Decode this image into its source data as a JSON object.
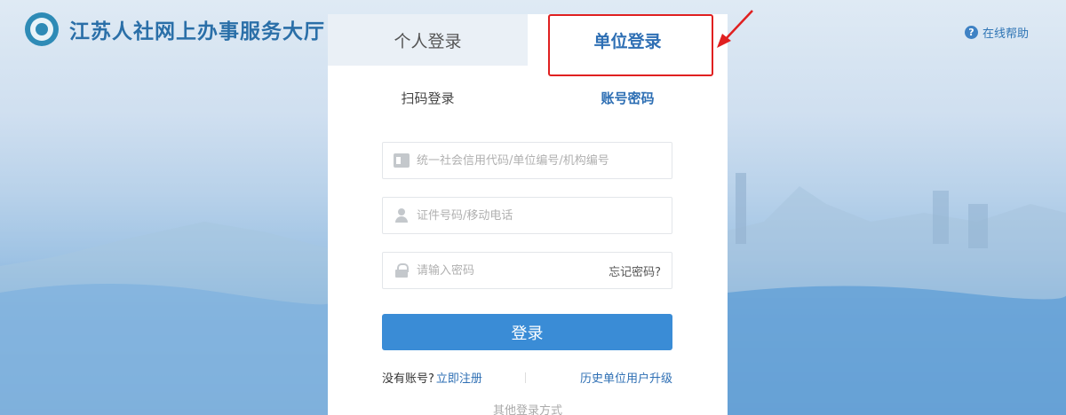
{
  "header": {
    "title": "江苏人社网上办事服务大厅",
    "help_label": "在线帮助"
  },
  "tabs": [
    {
      "label": "个人登录",
      "active": false
    },
    {
      "label": "单位登录",
      "active": true
    }
  ],
  "subtabs": [
    {
      "label": "扫码登录",
      "active": false
    },
    {
      "label": "账号密码",
      "active": true
    }
  ],
  "form": {
    "org_placeholder": "统一社会信用代码/单位编号/机构编号",
    "id_placeholder": "证件号码/移动电话",
    "password_placeholder": "请输入密码",
    "forgot_label": "忘记密码?",
    "login_label": "登录"
  },
  "links": {
    "no_account": "没有账号?",
    "register": "立即注册",
    "history_upgrade": "历史单位用户升级",
    "other_methods": "其他登录方式"
  },
  "colors": {
    "accent": "#3a8cd6",
    "highlight": "#e02020",
    "brand": "#2a6fa8"
  }
}
